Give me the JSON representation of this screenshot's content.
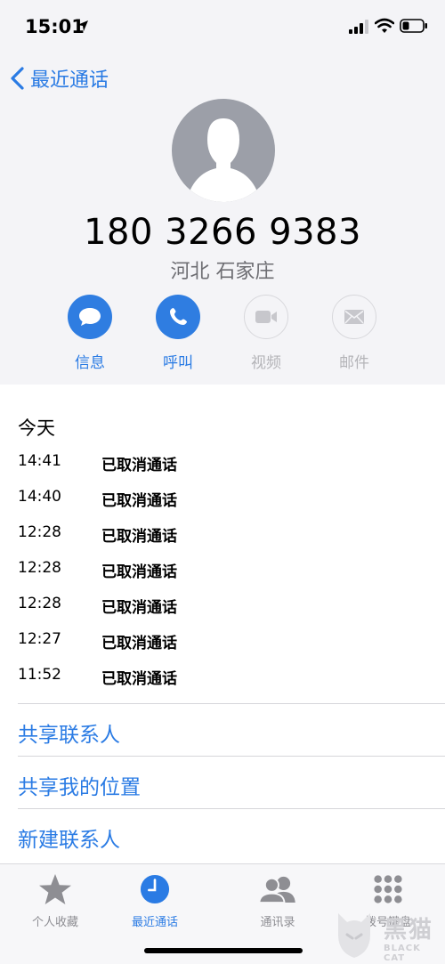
{
  "status_bar": {
    "time": "15:01"
  },
  "nav": {
    "back_label": "最近通话"
  },
  "contact": {
    "number": "180 3266 9383",
    "location": "河北 石家庄"
  },
  "actions": [
    {
      "label": "信息",
      "icon": "message-bubble-icon",
      "enabled": true
    },
    {
      "label": "呼叫",
      "icon": "phone-icon",
      "enabled": true
    },
    {
      "label": "视频",
      "icon": "video-camera-icon",
      "enabled": false
    },
    {
      "label": "邮件",
      "icon": "mail-icon",
      "enabled": false
    }
  ],
  "history": {
    "title": "今天",
    "calls": [
      {
        "time": "14:41",
        "status": "已取消通话"
      },
      {
        "time": "14:40",
        "status": "已取消通话"
      },
      {
        "time": "12:28",
        "status": "已取消通话"
      },
      {
        "time": "12:28",
        "status": "已取消通话"
      },
      {
        "time": "12:28",
        "status": "已取消通话"
      },
      {
        "time": "12:27",
        "status": "已取消通话"
      },
      {
        "time": "11:52",
        "status": "已取消通话"
      }
    ]
  },
  "links": [
    "共享联系人",
    "共享我的位置",
    "新建联系人"
  ],
  "tabs": [
    {
      "label": "个人收藏",
      "icon": "star-icon",
      "active": false
    },
    {
      "label": "最近通话",
      "icon": "clock-icon",
      "active": true
    },
    {
      "label": "通讯录",
      "icon": "contacts-icon",
      "active": false
    },
    {
      "label": "拨号键盘",
      "icon": "keypad-icon",
      "active": false
    }
  ],
  "watermark": {
    "text": "黑猫",
    "sub": "BLACK CAT"
  },
  "colors": {
    "accent": "#2a7be4",
    "header_bg": "#f4f4f7",
    "avatar_bg": "#9c9fa8"
  }
}
